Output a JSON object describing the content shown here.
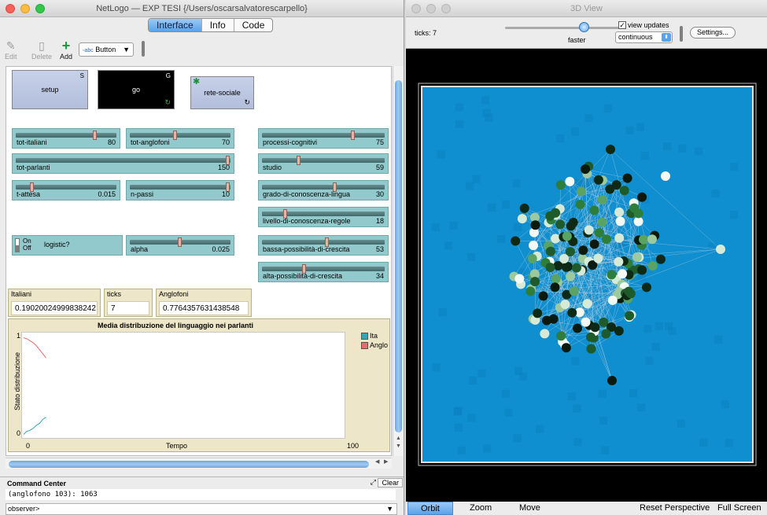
{
  "main_window": {
    "title": "NetLogo — EXP TESI  {/Users/oscarsalvatorescarpello}",
    "tabs": [
      "Interface",
      "Info",
      "Code"
    ],
    "active_tab": "Interface"
  },
  "toolbar": {
    "edit": "Edit",
    "delete": "Delete",
    "add": "Add",
    "widget_type": "Button"
  },
  "buttons": {
    "setup": {
      "label": "setup",
      "key": "S"
    },
    "go": {
      "label": "go",
      "key": "G"
    },
    "rete": {
      "label": "rete-sociale"
    }
  },
  "sliders": [
    {
      "name": "tot-italiani",
      "value": "80",
      "fraction": 0.8
    },
    {
      "name": "tot-anglofoni",
      "value": "70",
      "fraction": 0.45
    },
    {
      "name": "tot-parlanti",
      "value": "150",
      "fraction": 1.0
    },
    {
      "name": "t-attesa",
      "value": "0.015",
      "fraction": 0.15
    },
    {
      "name": "n-passi",
      "value": "10",
      "fraction": 1.0
    },
    {
      "name": "alpha",
      "value": "0.025",
      "fraction": 0.5
    },
    {
      "name": "processi-cognitivi",
      "value": "75",
      "fraction": 0.75
    },
    {
      "name": "studio",
      "value": "59",
      "fraction": 0.29
    },
    {
      "name": "grado-di-conoscenza-lingua",
      "value": "30",
      "fraction": 0.6
    },
    {
      "name": "livello-di-conoscenza-regole",
      "value": "18",
      "fraction": 0.18
    },
    {
      "name": "bassa-possibilità-di-crescita",
      "value": "53",
      "fraction": 0.53
    },
    {
      "name": "alta-possibilità-di-crescita",
      "value": "34",
      "fraction": 0.34
    }
  ],
  "switch": {
    "name": "logistic?",
    "on": "On",
    "off": "Off"
  },
  "monitors": [
    {
      "label": "Italiani",
      "value": "0.19020024999838242"
    },
    {
      "label": "ticks",
      "value": "7"
    },
    {
      "label": "Anglofoni",
      "value": "0.7764357631438548"
    }
  ],
  "plot": {
    "title": "Media distribuzione del linguaggio nei parlanti",
    "xlabel": "Tempo",
    "ylabel": "Stato distribuzione",
    "x_min": "0",
    "x_max": "100",
    "y_min": "0",
    "y_max": "1",
    "legend": [
      {
        "name": "Ita",
        "color": "#36a5b5"
      },
      {
        "name": "Anglo",
        "color": "#e46d6d"
      }
    ]
  },
  "chart_data": {
    "type": "line",
    "title": "Media distribuzione del linguaggio nei parlanti",
    "xlabel": "Tempo",
    "ylabel": "Stato distribuzione",
    "xlim": [
      0,
      100
    ],
    "ylim": [
      0,
      1
    ],
    "series": [
      {
        "name": "Ita",
        "color": "#36a5b5",
        "x": [
          0,
          1,
          2,
          3,
          4,
          5,
          6,
          7
        ],
        "y": [
          0.02,
          0.05,
          0.06,
          0.08,
          0.11,
          0.13,
          0.17,
          0.19
        ]
      },
      {
        "name": "Anglo",
        "color": "#e46d6d",
        "x": [
          0,
          1,
          2,
          3,
          4,
          5,
          6,
          7
        ],
        "y": [
          0.98,
          0.97,
          0.95,
          0.93,
          0.9,
          0.86,
          0.82,
          0.78
        ]
      }
    ]
  },
  "command_center": {
    "title": "Command Center",
    "clear": "Clear",
    "output": "(anglofono 103): 1063",
    "prompt": "observer>"
  },
  "view_window": {
    "title": "3D View",
    "ticks": "ticks: 7",
    "speed_label": "faster",
    "view_updates": "view updates",
    "update_mode": "continuous",
    "settings": "Settings...",
    "bottom": [
      "Orbit",
      "Zoom",
      "Move",
      "Reset Perspective",
      "Full Screen"
    ],
    "colors": {
      "world_bg": "#0f8ed0",
      "frame": "#e0e0e0"
    }
  }
}
